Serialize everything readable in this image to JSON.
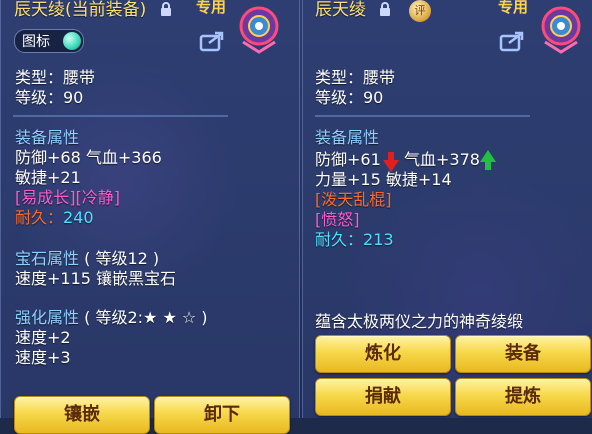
{
  "left": {
    "name": "辰天绫",
    "equipped_tag": "(当前装备)",
    "badge": "专用",
    "icon_toggle_label": "图标",
    "type_line": "类型：腰带",
    "level_line": "等级：90",
    "equip_attr_header": "装备属性",
    "attr_line1": "防御+68 气血+366",
    "attr_line2": "敏捷+21",
    "special_line": "[易成长][冷静]",
    "durability_label": "耐久：",
    "durability_value": "240",
    "gem_header": "宝石属性",
    "gem_level": "( 等级12 )",
    "gem_line": "速度+115 镶嵌黑宝石",
    "enhance_header": "强化属性",
    "enhance_level": "( 等级2:★ ★ ☆ )",
    "enhance_line1": "速度+2",
    "enhance_line2": "速度+3",
    "btn_inlay": "镶嵌",
    "btn_unequip": "卸下"
  },
  "right": {
    "name": "辰天绫",
    "badge": "专用",
    "rating_icon_label": "评",
    "type_line": "类型：腰带",
    "level_line": "等级：90",
    "equip_attr_header": "装备属性",
    "defense": "防御+61",
    "hp": "气血+378",
    "attr_line2": "力量+15 敏捷+14",
    "special1": "[泼天乱棍]",
    "special2": "[愤怒]",
    "durability_label": "耐久：",
    "durability_value": "213",
    "description": "蕴含太极两仪之力的神奇绫缎",
    "btn_refine": "炼化",
    "btn_equip": "装备",
    "btn_donate": "捐献",
    "btn_extract": "提炼"
  },
  "colors": {
    "title": "#ffe070",
    "section": "#8fd0ff",
    "special": "#ff5ad0",
    "durability": "#4fe0ff",
    "button": "#f7d84a"
  },
  "icons": [
    "lock-icon",
    "share-icon",
    "emblem-icon",
    "rating-icon",
    "arrow-down-icon",
    "arrow-up-icon",
    "orb-toggle-icon"
  ]
}
